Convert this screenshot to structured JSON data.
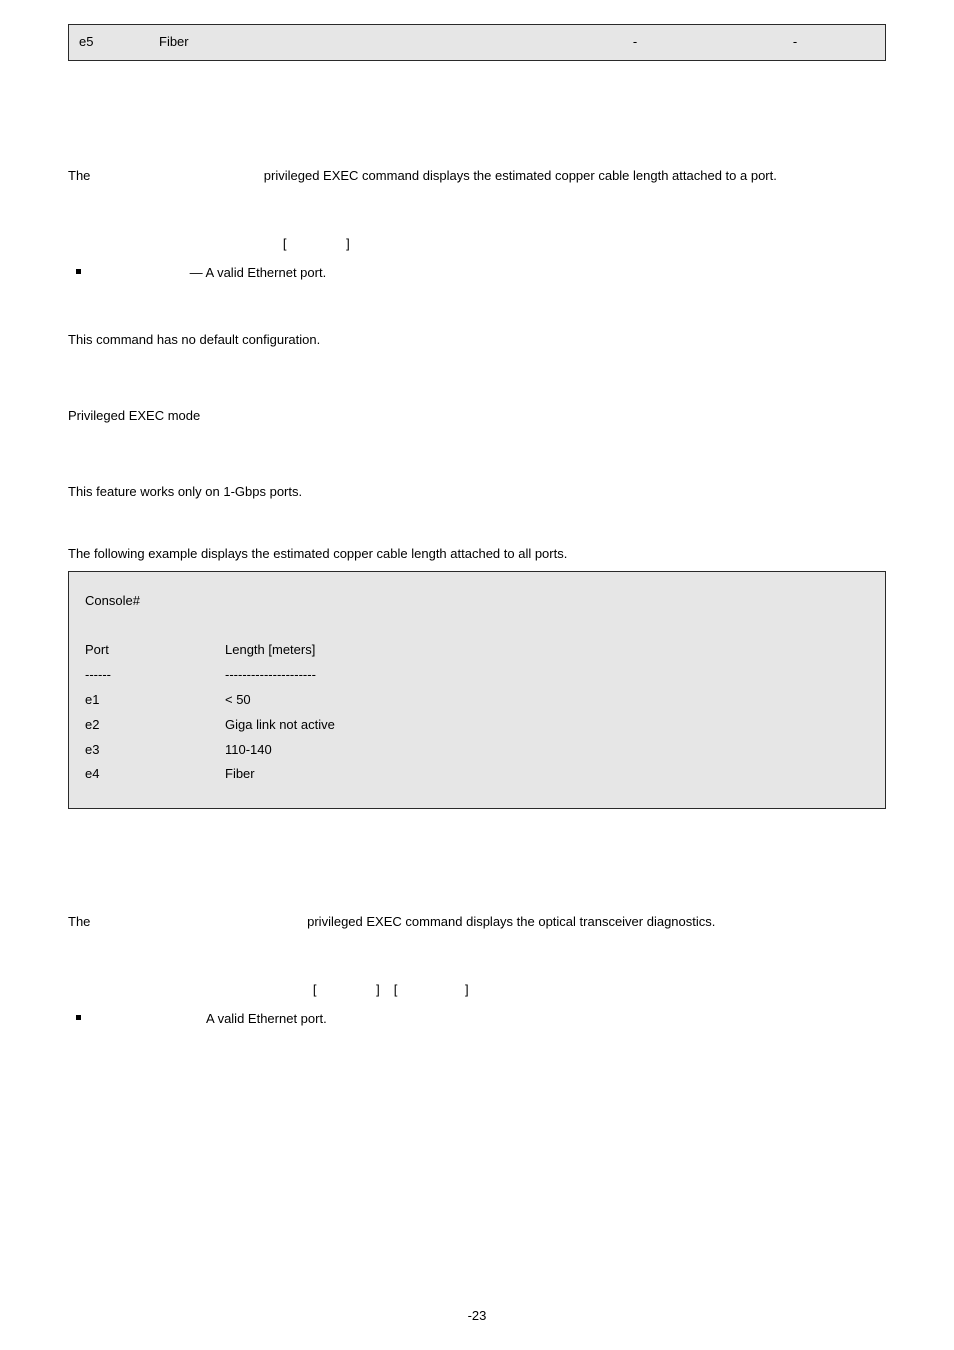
{
  "top_box": {
    "c1": "e5",
    "c2": "Fiber",
    "c3": "-",
    "c4": "-"
  },
  "sec1": {
    "intro_1": "The ",
    "intro_2": " privileged EXEC command displays the estimated copper cable length attached to a port.",
    "syntax_lead": " ",
    "syntax_l": "[",
    "syntax_mid": " ",
    "syntax_r": "]",
    "bullet1_pre": " ",
    "bullet1_rest": " — A valid Ethernet port.",
    "default_cfg": "This command has no default configuration.",
    "mode": "Privileged EXEC mode",
    "guideline": "This feature works only on 1-Gbps ports.",
    "example_intro": "The following example displays the estimated copper cable length attached to all ports.",
    "console": "Console#",
    "hdr_port": "Port",
    "hdr_len": "Length [meters]",
    "dash1": "------",
    "dash2": "---------------------",
    "rows": [
      {
        "p": "e1",
        "v": "< 50"
      },
      {
        "p": "e2",
        "v": "Giga link not active"
      },
      {
        "p": "e3",
        "v": "110-140"
      },
      {
        "p": "e4",
        "v": "Fiber"
      }
    ]
  },
  "sec2": {
    "intro_1": "The ",
    "intro_2": " privileged EXEC command displays the optical transceiver diagnostics.",
    "syntax_lead": " ",
    "syntax_l1": "[",
    "syntax_mid1": " ",
    "syntax_r1": "]",
    "syntax_l2": "[",
    "syntax_mid2": " ",
    "syntax_r2": "]",
    "bullet1_pre": " ",
    "bullet1_rest": "A valid Ethernet port."
  },
  "footer": "-23"
}
